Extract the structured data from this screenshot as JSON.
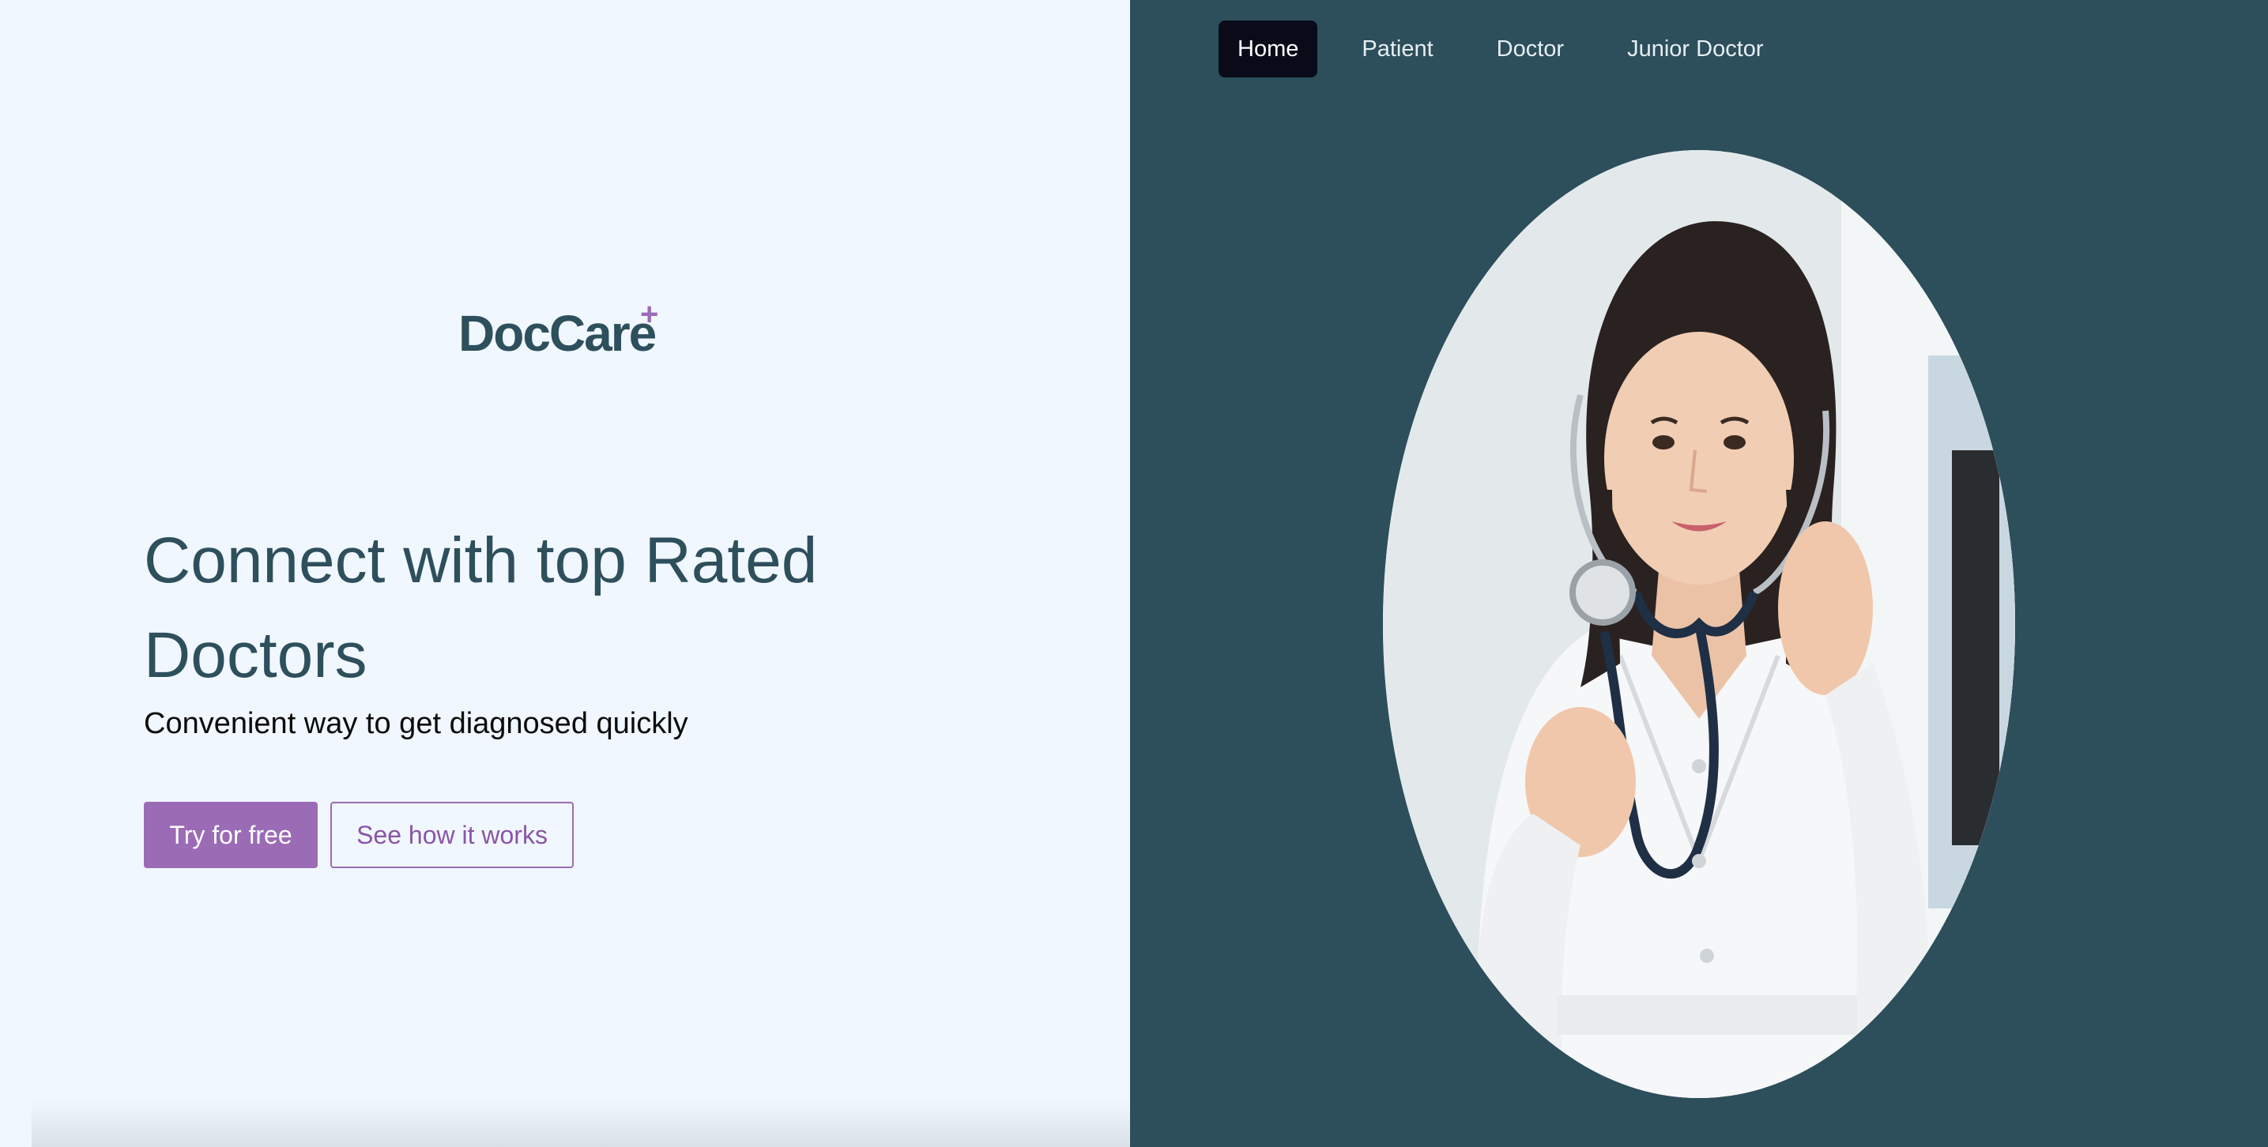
{
  "brand": {
    "name": "DocCare",
    "mark": "+",
    "colors": {
      "primary": "#2e4f5c",
      "accent": "#9b6bb5",
      "panel_bg": "#2d4e5b",
      "page_bg": "#f0f7fe"
    }
  },
  "hero": {
    "headline": "Connect with top Rated Doctors",
    "subheadline": "Convenient way to get diagnosed quickly",
    "primary_cta": "Try for free",
    "secondary_cta": "See how it works"
  },
  "nav": {
    "items": [
      {
        "label": "Home",
        "active": true
      },
      {
        "label": "Patient",
        "active": false
      },
      {
        "label": "Doctor",
        "active": false
      },
      {
        "label": "Junior Doctor",
        "active": false
      }
    ]
  },
  "image": {
    "subject": "doctor-with-stethoscope"
  }
}
